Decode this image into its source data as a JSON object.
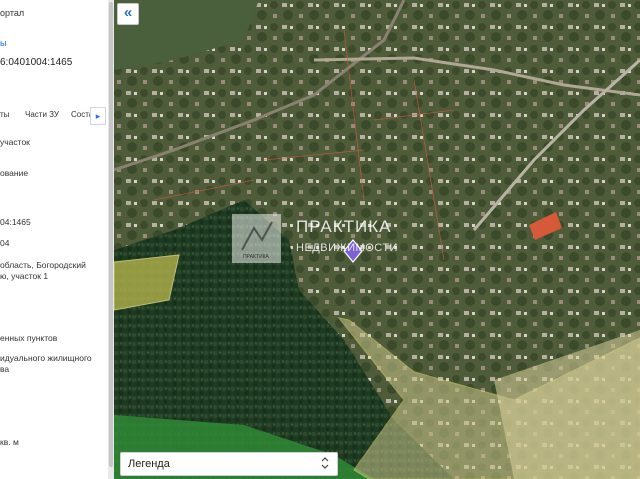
{
  "panel": {
    "portal_text": "ортал",
    "link_text": "ы",
    "cadastral_number": "6:0401004:1465",
    "tabs": [
      "ты",
      "Части ЗУ",
      "Соста"
    ],
    "tab_more_glyph": "▸",
    "rows": [
      "участок",
      "ование",
      "04:1465",
      "04",
      "область, Богородский",
      "ю, участок 1",
      "енных пунктов",
      "идуального жилищного",
      "ва",
      "кв. м"
    ]
  },
  "map": {
    "collapse_glyph": "«",
    "watermark_title": "ПРАКТИКА",
    "watermark_subtitle": "НЕДВИЖИМОСТИ",
    "watermark_logo_caption": "ПРАКТИКА"
  },
  "legend": {
    "label": "Легенда",
    "chevron_glyph": "⌃⌄"
  }
}
